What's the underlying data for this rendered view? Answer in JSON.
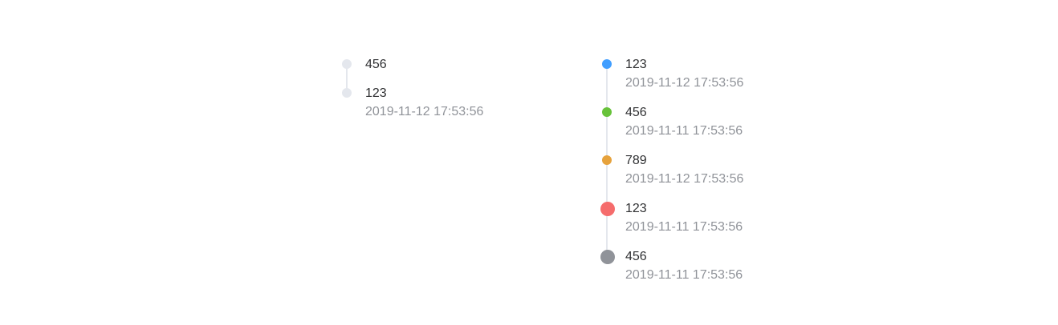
{
  "timeline_left": {
    "items": [
      {
        "content": "456",
        "timestamp": "",
        "node_color": "#e4e7ed",
        "node_size": "normal"
      },
      {
        "content": "123",
        "timestamp": "2019-11-12 17:53:56",
        "node_color": "#e4e7ed",
        "node_size": "normal"
      }
    ]
  },
  "timeline_right": {
    "items": [
      {
        "content": "123",
        "timestamp": "2019-11-12 17:53:56",
        "node_color": "#409eff",
        "node_size": "normal"
      },
      {
        "content": "456",
        "timestamp": "2019-11-11 17:53:56",
        "node_color": "#67c23a",
        "node_size": "normal"
      },
      {
        "content": "789",
        "timestamp": "2019-11-12 17:53:56",
        "node_color": "#e6a23c",
        "node_size": "normal"
      },
      {
        "content": "123",
        "timestamp": "2019-11-11 17:53:56",
        "node_color": "#f56c6c",
        "node_size": "large"
      },
      {
        "content": "456",
        "timestamp": "2019-11-11 17:53:56",
        "node_color": "#909399",
        "node_size": "large"
      }
    ]
  }
}
